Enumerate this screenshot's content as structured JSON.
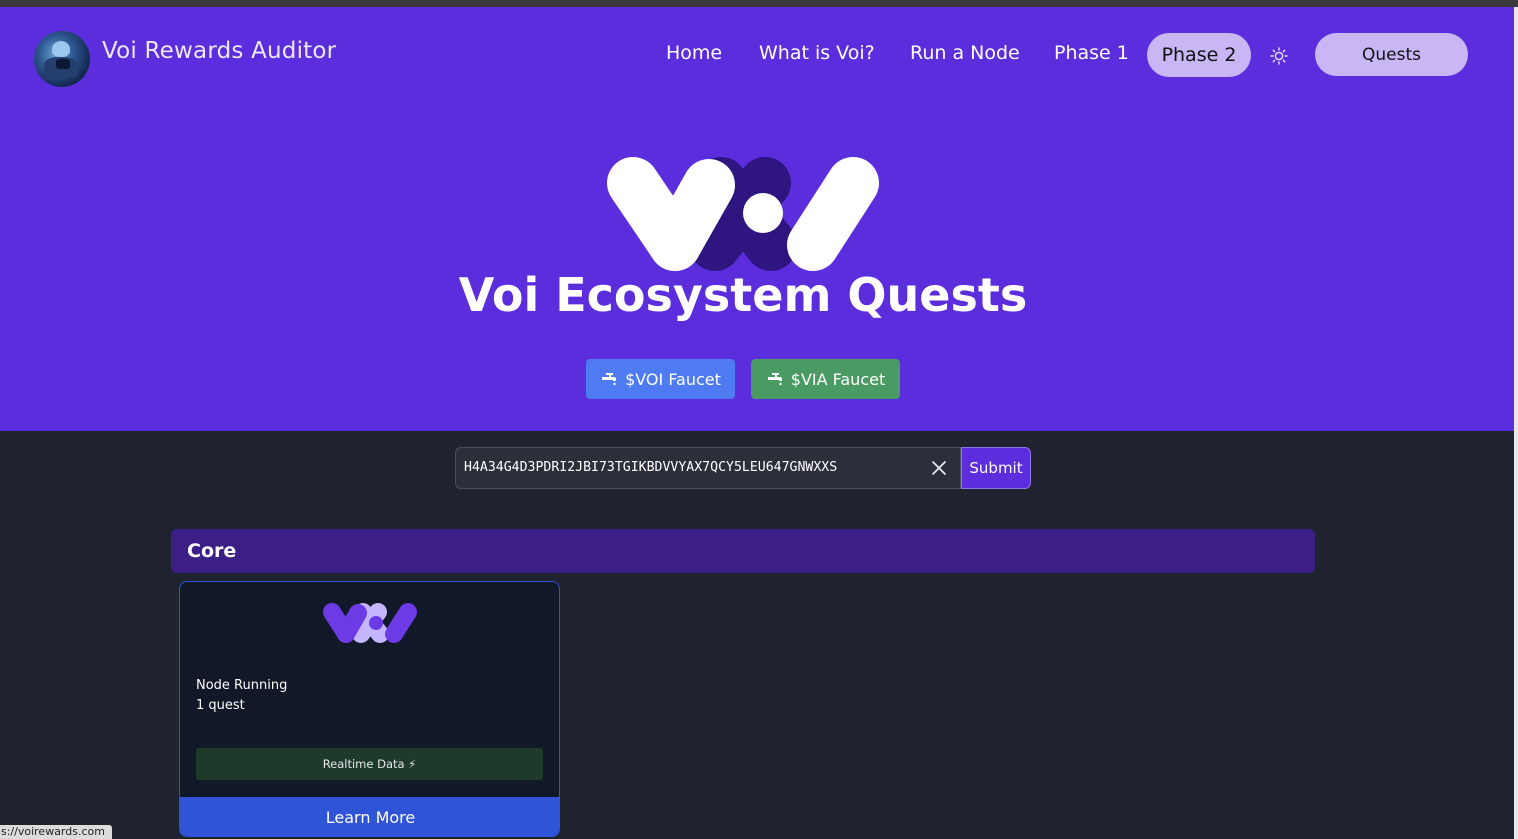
{
  "header": {
    "brand": "Voi Rewards Auditor",
    "nav": [
      {
        "label": "Home"
      },
      {
        "label": "What is Voi?"
      },
      {
        "label": "Run a Node"
      },
      {
        "label": "Phase 1"
      },
      {
        "label": "Phase 2",
        "active": true
      }
    ],
    "theme_icon": "sun-icon",
    "quests_label": "Quests"
  },
  "hero": {
    "title": "Voi Ecosystem Quests",
    "voi_faucet_label": "$VOI Faucet",
    "via_faucet_label": "$VIA Faucet",
    "faucet_icon": "faucet-icon"
  },
  "search": {
    "value": "H4A34G4D3PDRI2JBI73TGIKBDVVYAX7QCY5LEU647GNWXXS",
    "clear_icon": "close-icon",
    "submit_label": "Submit"
  },
  "section": {
    "title": "Core",
    "cards": [
      {
        "name": "Node Running",
        "count": "1 quest",
        "badge": "Realtime Data ⚡",
        "button": "Learn More"
      }
    ]
  },
  "status_bar": {
    "url": "s://voirewards.com"
  },
  "colors": {
    "hero_bg": "#5b2ddc",
    "page_bg": "#1f2330",
    "pill_bg": "#c8b6f5",
    "voi_faucet": "#4e7bf2",
    "via_faucet": "#4a9a63",
    "card_button": "#2f54d8",
    "section_bar": "#3b1e86"
  }
}
